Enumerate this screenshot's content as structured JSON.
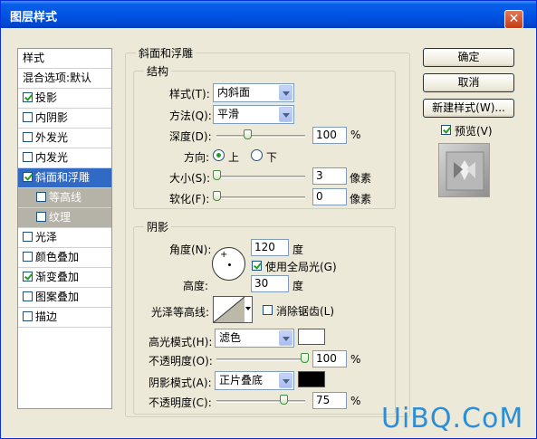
{
  "window": {
    "title": "图层样式",
    "close_glyph": "✕"
  },
  "left_panel": {
    "items": [
      {
        "label": "样式",
        "checkbox": false,
        "checked": false,
        "state": "header"
      },
      {
        "label": "混合选项:默认",
        "checkbox": false,
        "checked": false,
        "state": "normal"
      },
      {
        "label": "投影",
        "checkbox": true,
        "checked": true,
        "state": "normal"
      },
      {
        "label": "内阴影",
        "checkbox": true,
        "checked": false,
        "state": "normal"
      },
      {
        "label": "外发光",
        "checkbox": true,
        "checked": false,
        "state": "normal"
      },
      {
        "label": "内发光",
        "checkbox": true,
        "checked": false,
        "state": "normal"
      },
      {
        "label": "斜面和浮雕",
        "checkbox": true,
        "checked": true,
        "state": "selected"
      },
      {
        "label": "等高线",
        "checkbox": true,
        "checked": false,
        "state": "sub"
      },
      {
        "label": "纹理",
        "checkbox": true,
        "checked": false,
        "state": "sub"
      },
      {
        "label": "光泽",
        "checkbox": true,
        "checked": false,
        "state": "normal"
      },
      {
        "label": "颜色叠加",
        "checkbox": true,
        "checked": false,
        "state": "normal"
      },
      {
        "label": "渐变叠加",
        "checkbox": true,
        "checked": true,
        "state": "normal"
      },
      {
        "label": "图案叠加",
        "checkbox": true,
        "checked": false,
        "state": "normal"
      },
      {
        "label": "描边",
        "checkbox": true,
        "checked": false,
        "state": "normal"
      }
    ]
  },
  "bevel": {
    "title": "斜面和浮雕",
    "structure": {
      "title": "结构",
      "style_label": "样式(T):",
      "style_value": "内斜面",
      "method_label": "方法(Q):",
      "method_value": "平滑",
      "depth_label": "深度(D):",
      "depth_value": "100",
      "depth_unit": "%",
      "direction_label": "方向:",
      "dir_up": "上",
      "dir_down": "下",
      "size_label": "大小(S):",
      "size_value": "3",
      "size_unit": "像素",
      "soften_label": "软化(F):",
      "soften_value": "0",
      "soften_unit": "像素"
    },
    "shading": {
      "title": "阴影",
      "angle_label": "角度(N):",
      "angle_value": "120",
      "angle_unit": "度",
      "global_light_label": "使用全局光(G)",
      "global_light_checked": true,
      "altitude_label": "高度:",
      "altitude_value": "30",
      "altitude_unit": "度",
      "gloss_contour_label": "光泽等高线:",
      "antialias_label": "消除锯齿(L)",
      "antialias_checked": false,
      "highlight_mode_label": "高光模式(H):",
      "highlight_mode_value": "滤色",
      "highlight_color": "#ffffff",
      "highlight_opacity_label": "不透明度(O):",
      "highlight_opacity_value": "100",
      "highlight_opacity_unit": "%",
      "shadow_mode_label": "阴影模式(A):",
      "shadow_mode_value": "正片叠底",
      "shadow_color": "#000000",
      "shadow_opacity_label": "不透明度(C):",
      "shadow_opacity_value": "75",
      "shadow_opacity_unit": "%"
    }
  },
  "buttons": {
    "ok": "确定",
    "cancel": "取消",
    "new_style": "新建样式(W)...",
    "preview_label": "预览(V)",
    "preview_checked": true
  },
  "watermark": "UiBQ.CoM"
}
